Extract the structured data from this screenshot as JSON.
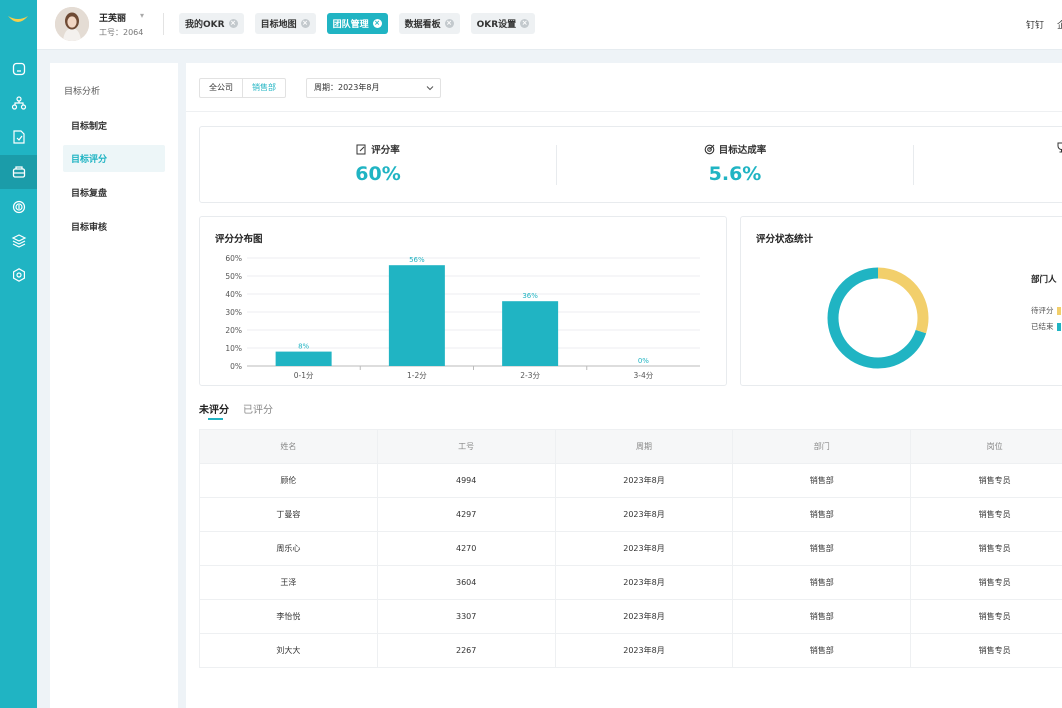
{
  "rail": {
    "icons": [
      "home-icon",
      "org-tree-icon",
      "document-icon",
      "team-icon",
      "fingerprint-icon",
      "layers-icon",
      "settings-icon"
    ],
    "active_index": 3
  },
  "topbar": {
    "user_name": "王芙丽",
    "user_id": "工号：2064",
    "tabs": [
      {
        "label": "我的OKR"
      },
      {
        "label": "目标地图"
      },
      {
        "label": "团队管理"
      },
      {
        "label": "数据看板"
      },
      {
        "label": "OKR设置"
      }
    ],
    "active_tab": 2,
    "right_link": "钉钉",
    "right_link_2": "企"
  },
  "subnav": {
    "title": "目标分析",
    "items": [
      {
        "label": "目标制定"
      },
      {
        "label": "目标评分"
      },
      {
        "label": "目标复盘"
      },
      {
        "label": "目标审核"
      }
    ],
    "active_index": 1
  },
  "filters": {
    "scope_all": "全公司",
    "scope_dept": "销售部",
    "period": "周期：2023年8月"
  },
  "kpis": [
    {
      "label": "评分率",
      "value": "60%",
      "icon": "edit-icon"
    },
    {
      "label": "目标达成率",
      "value": "5.6%",
      "icon": "target-icon"
    }
  ],
  "dist_card": {
    "title": "评分分布图"
  },
  "status_card": {
    "title": "评分状态统计",
    "legend_title": "部门人",
    "legend": [
      {
        "label": "待评分",
        "color": "#f2cf6b"
      },
      {
        "label": "已结束",
        "color": "#20b4c3"
      }
    ]
  },
  "chart_data": [
    {
      "type": "bar",
      "title": "评分分布图",
      "categories": [
        "0-1分",
        "1-2分",
        "2-3分",
        "3-4分"
      ],
      "values": [
        8,
        56,
        36,
        0
      ],
      "value_labels": [
        "8%",
        "56%",
        "36%",
        "0%"
      ],
      "y_ticks": [
        "0%",
        "10%",
        "20%",
        "30%",
        "40%",
        "50%",
        "60%"
      ],
      "ylim": [
        0,
        60
      ],
      "grid": true,
      "color": "#20b4c3"
    },
    {
      "type": "pie",
      "title": "评分状态统计",
      "labels": [
        "已结束",
        "待评分"
      ],
      "values": [
        70,
        30
      ],
      "colors": [
        "#20b4c3",
        "#f2cf6b"
      ]
    }
  ],
  "list_tabs": {
    "unrated": "未评分",
    "rated": "已评分"
  },
  "table": {
    "headers": [
      "姓名",
      "工号",
      "周期",
      "部门",
      "岗位"
    ],
    "rows": [
      [
        "顾伦",
        "4994",
        "2023年8月",
        "销售部",
        "销售专员"
      ],
      [
        "丁曼容",
        "4297",
        "2023年8月",
        "销售部",
        "销售专员"
      ],
      [
        "周乐心",
        "4270",
        "2023年8月",
        "销售部",
        "销售专员"
      ],
      [
        "王泽",
        "3604",
        "2023年8月",
        "销售部",
        "销售专员"
      ],
      [
        "李怡悦",
        "3307",
        "2023年8月",
        "销售部",
        "销售专员"
      ],
      [
        "刘大大",
        "2267",
        "2023年8月",
        "销售部",
        "销售专员"
      ]
    ]
  }
}
